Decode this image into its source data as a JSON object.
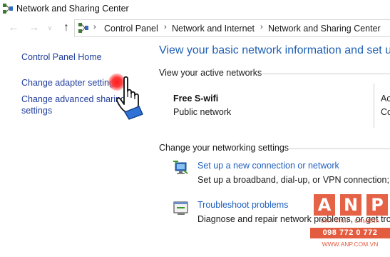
{
  "window": {
    "title": "Network and Sharing Center",
    "title_icon": "network-center-icon"
  },
  "navigation": {
    "back_icon": "back-arrow-icon",
    "forward_icon": "forward-arrow-icon",
    "recent_icon": "chevron-down-icon",
    "up_icon": "up-arrow-icon",
    "address_icon": "control-panel-icon",
    "breadcrumbs": [
      "Control Panel",
      "Network and Internet",
      "Network and Sharing Center"
    ],
    "separator": "›"
  },
  "sidebar": {
    "items": [
      {
        "label": "Control Panel Home"
      },
      {
        "label": "Change adapter settings"
      },
      {
        "label_line1": "Change advanced sharing",
        "label_line2": "settings"
      }
    ]
  },
  "main": {
    "heading": "View your basic network information and set u",
    "active_networks": {
      "label": "View your active networks",
      "network_name": "Free S-wifi",
      "network_category": "Public network",
      "clipped_col_1": "Ac",
      "clipped_col_2": "Co"
    },
    "networking_settings": {
      "label": "Change your networking settings",
      "tasks": [
        {
          "icon": "new-connection-icon",
          "link": "Set up a new connection or network",
          "description": "Set up a broadband, dial-up, or VPN connection; or"
        },
        {
          "icon": "troubleshoot-icon",
          "link": "Troubleshoot problems",
          "description": "Diagnose and repair network problems, or get troub"
        }
      ]
    }
  },
  "overlay": {
    "pointer_icon": "pointing-hand-icon",
    "click_color": "#ff1e1e"
  },
  "watermark": {
    "letters": [
      "A",
      "N",
      "P"
    ],
    "tagline": "MÁY TÍNH - CAMERA",
    "phone": "098 772 0 772",
    "site": "WWW.ANP.COM.VN",
    "color": "#e0401e"
  }
}
